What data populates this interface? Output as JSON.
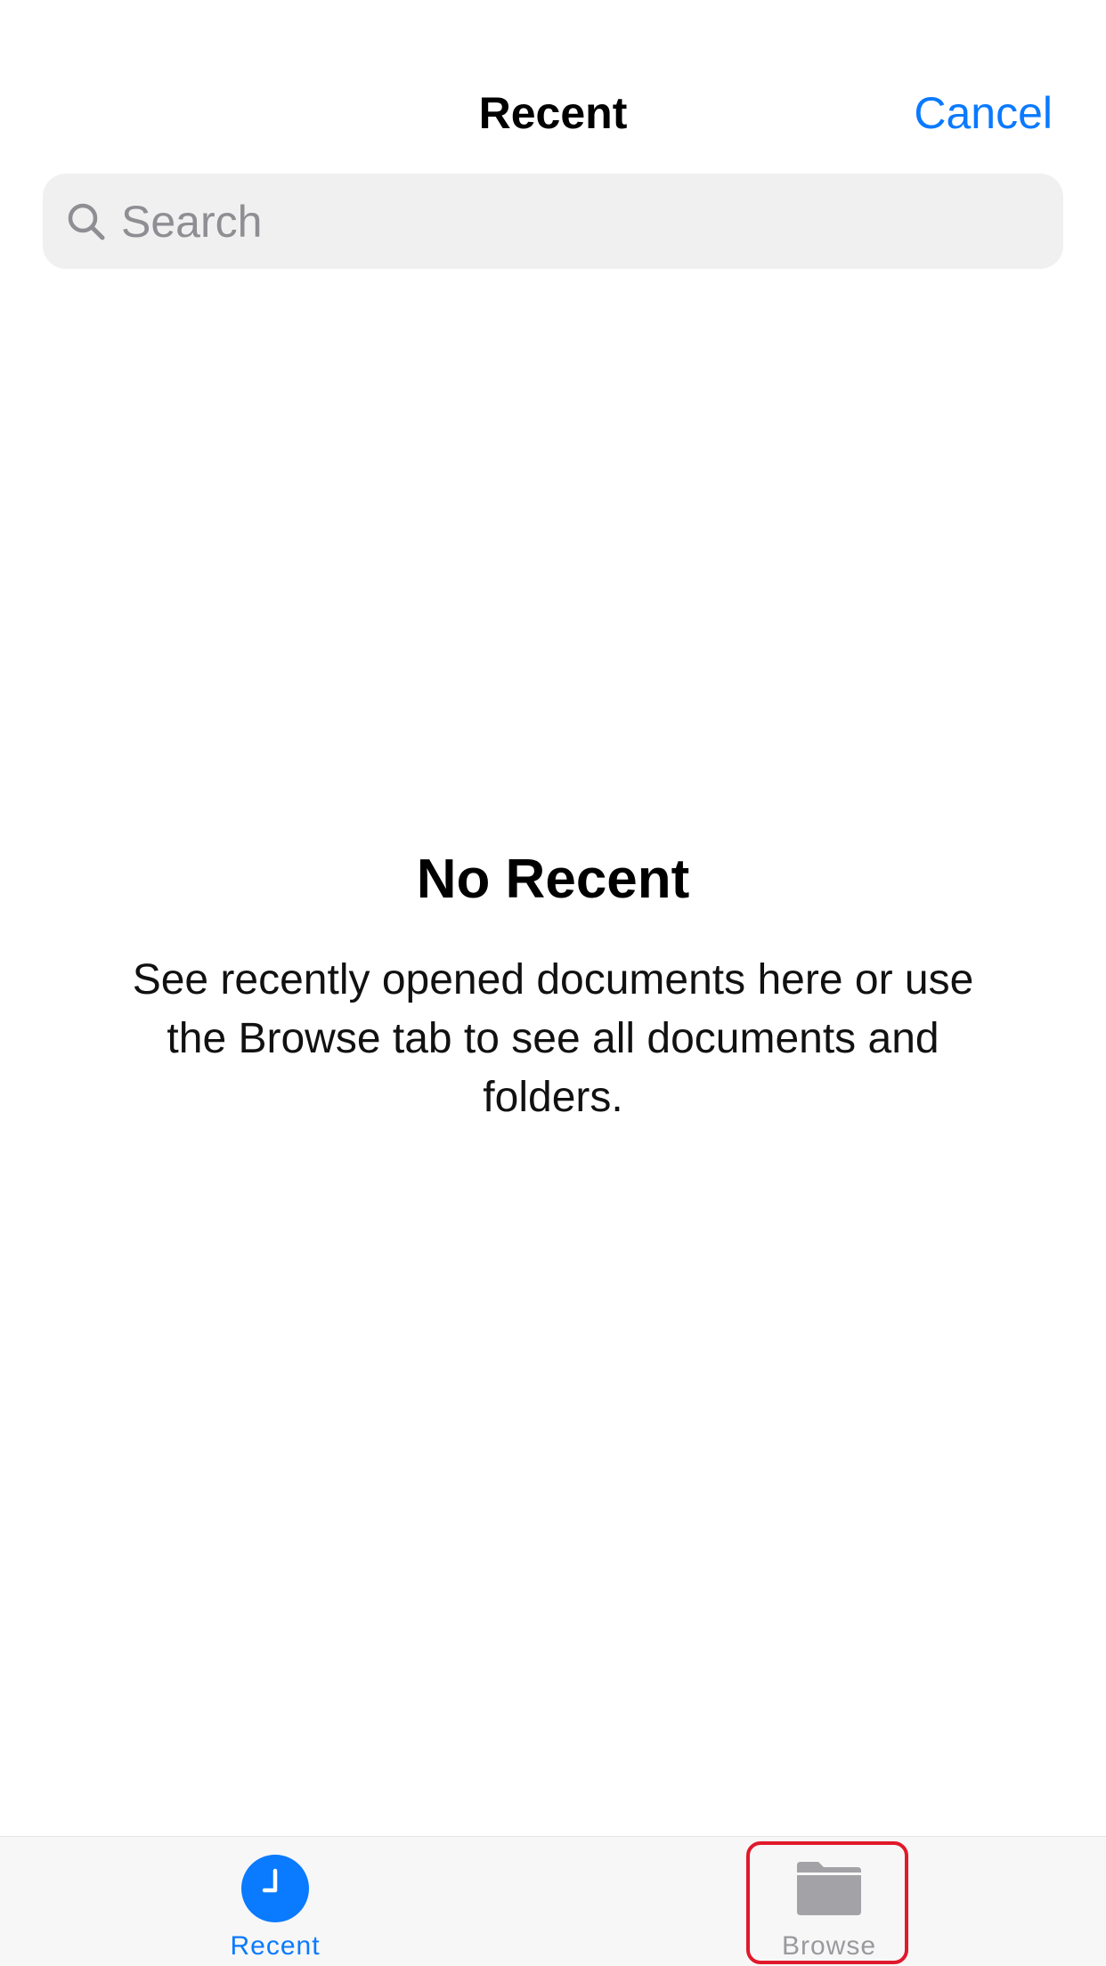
{
  "header": {
    "title": "Recent",
    "cancel_label": "Cancel"
  },
  "search": {
    "placeholder": "Search",
    "value": ""
  },
  "empty_state": {
    "title": "No Recent",
    "description": "See recently opened documents here or use the Browse tab to see all documents and folders."
  },
  "tab_bar": {
    "tabs": [
      {
        "label": "Recent",
        "icon": "clock-icon",
        "selected": true
      },
      {
        "label": "Browse",
        "icon": "folder-icon",
        "selected": false
      }
    ]
  },
  "colors": {
    "accent": "#0a7aff",
    "inactive": "#9a9a9e",
    "highlight": "#e0192b",
    "search_bg": "#f0f0f1"
  }
}
